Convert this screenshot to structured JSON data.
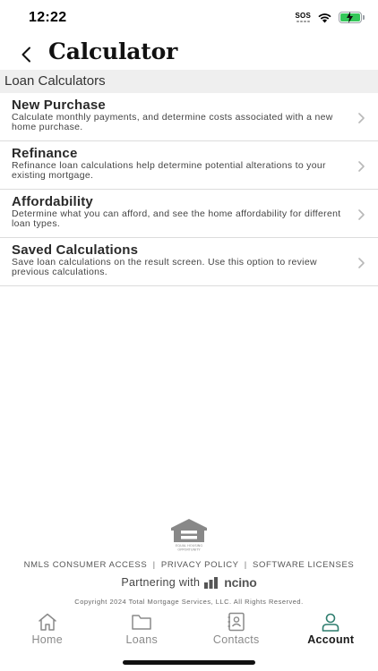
{
  "status_bar": {
    "time": "12:22",
    "sos_label": "SOS",
    "battery_color": "#34c759"
  },
  "header": {
    "title": "Calculator",
    "back_icon": "chevron-left-icon"
  },
  "section": {
    "title": "Loan Calculators"
  },
  "calculators": [
    {
      "title": "New Purchase",
      "description": "Calculate monthly payments, and determine costs associated with a new home purchase."
    },
    {
      "title": "Refinance",
      "description": "Refinance loan calculations help determine potential alterations to your existing mortgage."
    },
    {
      "title": "Affordability",
      "description": "Determine what you can afford, and see the home affordability for different loan types."
    },
    {
      "title": "Saved Calculations",
      "description": "Save loan calculations on the result screen. Use this option to review previous calculations."
    }
  ],
  "footer": {
    "logo_line1": "EQUAL HOUSING",
    "logo_line2": "OPPORTUNITY",
    "links": [
      "NMLS CONSUMER ACCESS",
      "PRIVACY POLICY",
      "SOFTWARE LICENSES"
    ],
    "separator": "|",
    "partnering_text": "Partnering with",
    "partner_name": "ncino",
    "copyright": "Copyright 2024 Total Mortgage Services, LLC. All Rights Reserved."
  },
  "tabs": [
    {
      "label": "Home",
      "icon": "home-icon",
      "active": false
    },
    {
      "label": "Loans",
      "icon": "folder-icon",
      "active": false
    },
    {
      "label": "Contacts",
      "icon": "contacts-book-icon",
      "active": false
    },
    {
      "label": "Account",
      "icon": "person-icon",
      "active": true
    }
  ],
  "colors": {
    "accent": "#2e7d6e",
    "section_bg": "#efefef"
  }
}
